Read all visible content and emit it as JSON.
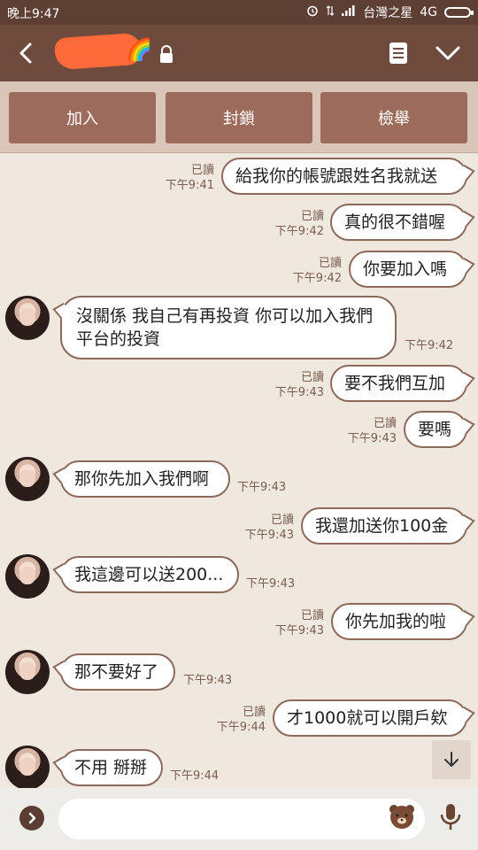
{
  "status_bar": {
    "time": "晚上9:47",
    "carrier": "台灣之星",
    "network": "4G"
  },
  "header": {
    "back_icon": "back-arrow-icon",
    "lock_icon": "lock-icon",
    "menu_icon": "notes-icon",
    "more_icon": "chevron-down-icon"
  },
  "actions": {
    "add": "加入",
    "block": "封鎖",
    "report": "檢舉"
  },
  "messages": [
    {
      "dir": "out",
      "read": "已讀",
      "time": "下午9:41",
      "text": "給我你的帳號跟姓名我就送"
    },
    {
      "dir": "out",
      "read": "已讀",
      "time": "下午9:42",
      "text": "真的很不錯喔"
    },
    {
      "dir": "out",
      "read": "已讀",
      "time": "下午9:42",
      "text": "你要加入嗎"
    },
    {
      "dir": "in",
      "time": "下午9:42",
      "text": "沒關係 我自己有再投資 你可以加入我們平台的投資"
    },
    {
      "dir": "out",
      "read": "已讀",
      "time": "下午9:43",
      "text": "要不我們互加"
    },
    {
      "dir": "out",
      "read": "已讀",
      "time": "下午9:43",
      "text": "要嗎"
    },
    {
      "dir": "in",
      "time": "下午9:43",
      "text": "那你先加入我們啊"
    },
    {
      "dir": "out",
      "read": "已讀",
      "time": "下午9:43",
      "text": "我還加送你100金"
    },
    {
      "dir": "in",
      "time": "下午9:43",
      "text": "我這邊可以送200..."
    },
    {
      "dir": "out",
      "read": "已讀",
      "time": "下午9:43",
      "text": "你先加我的啦"
    },
    {
      "dir": "in",
      "time": "下午9:43",
      "text": "那不要好了"
    },
    {
      "dir": "out",
      "read": "已讀",
      "time": "下午9:44",
      "text": "才1000就可以開戶欸"
    },
    {
      "dir": "in",
      "time": "下午9:44",
      "text": "不用 掰掰"
    }
  ],
  "input": {
    "expand_icon": "chevron-right-icon",
    "sticker_icon": "bear-sticker-icon",
    "mic_icon": "microphone-icon",
    "scroll_icon": "arrow-down-icon"
  }
}
